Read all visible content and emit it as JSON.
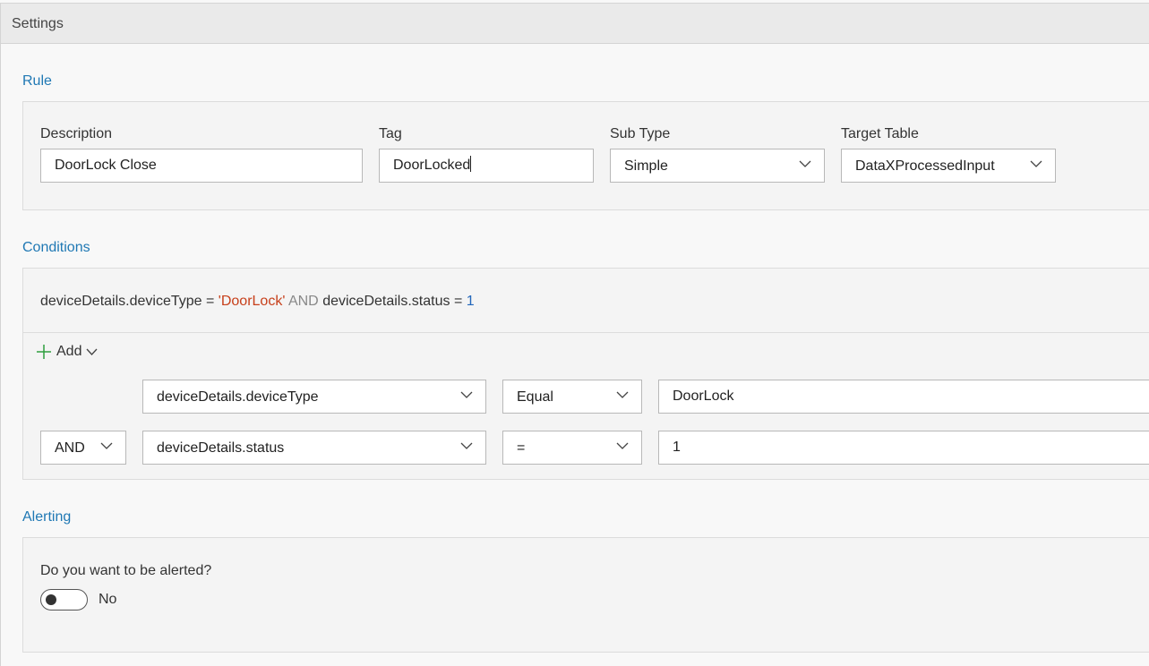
{
  "header": {
    "title": "Settings"
  },
  "rule": {
    "section_title": "Rule",
    "description": {
      "label": "Description",
      "value": "DoorLock Close"
    },
    "tag": {
      "label": "Tag",
      "value": "DoorLocked"
    },
    "sub_type": {
      "label": "Sub Type",
      "value": "Simple"
    },
    "target_table": {
      "label": "Target Table",
      "value": "DataXProcessedInput"
    }
  },
  "conditions": {
    "section_title": "Conditions",
    "query": {
      "field1": "deviceDetails.deviceType",
      "op1": "=",
      "value1": "'DoorLock'",
      "joiner": "AND",
      "field2": "deviceDetails.status",
      "op2": "=",
      "value2": "1"
    },
    "add_label": "Add",
    "rows": [
      {
        "field": "deviceDetails.deviceType",
        "operator": "Equal",
        "value": "DoorLock"
      },
      {
        "conjunction": "AND",
        "field": "deviceDetails.status",
        "operator": "=",
        "value": "1"
      }
    ]
  },
  "alerting": {
    "section_title": "Alerting",
    "question": "Do you want to be alerted?",
    "toggle_label": "No",
    "toggle_on": false
  },
  "icons": {
    "chevron": "chevron-down-icon",
    "add": "plus-icon"
  },
  "colors": {
    "section_title": "#1f78b4",
    "query_string": "#c7401b",
    "query_keyword": "#888888",
    "query_number": "#2266bb",
    "add_plus": "#2e9e3e"
  }
}
